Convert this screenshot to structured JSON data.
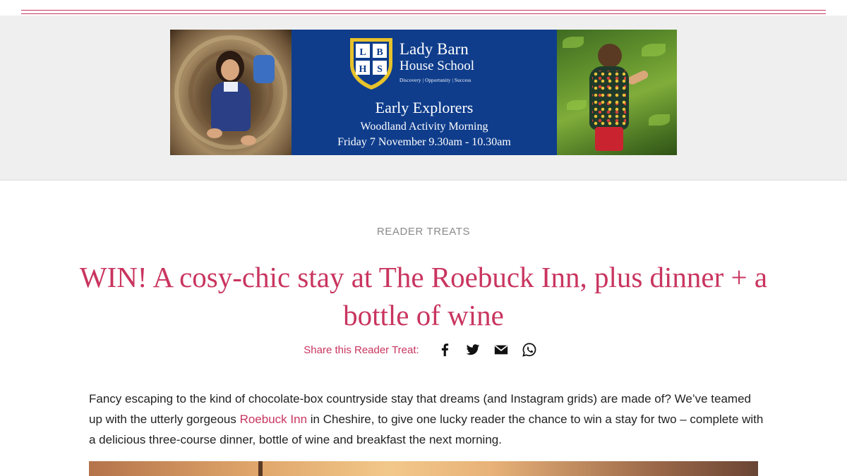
{
  "ad": {
    "school_line1": "Lady Barn",
    "school_line2": "House School",
    "crest_letters": [
      "L",
      "B",
      "H",
      "S"
    ],
    "tagline": "Discovery | Opportunity | Success",
    "heading": "Early Explorers",
    "subheading": "Woodland Activity Morning",
    "date": "Friday 7 November 9.30am - 10.30am",
    "colors": {
      "navy": "#0f3d8c",
      "gold": "#e7c22b"
    }
  },
  "article": {
    "eyebrow": "READER TREATS",
    "headline": "WIN! A cosy-chic stay at The Roebuck Inn, plus dinner + a bottle of wine",
    "share_label": "Share this Reader Treat:",
    "share_icons": [
      "facebook-icon",
      "twitter-icon",
      "email-icon",
      "whatsapp-icon"
    ],
    "para_part1": "Fancy escaping to the kind of chocolate-box countryside stay that dreams (and Instagram grids) are made of? We’ve teamed up with the utterly gorgeous ",
    "para_link": "Roebuck Inn",
    "para_part2": " in Cheshire, to give one lucky reader the chance to win a stay for two – complete with a delicious three-course dinner, bottle of wine and breakfast the next morning."
  },
  "colors": {
    "accent": "#c9355f",
    "muted": "#8a8a8a"
  }
}
